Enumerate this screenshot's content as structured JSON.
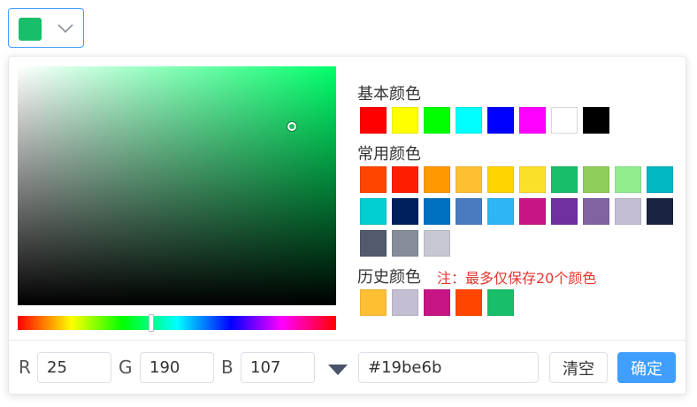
{
  "current_color": "#19be6b",
  "picker": {
    "hue_color": "#00ff6a",
    "hue_degrees": 150,
    "saturation_percent": 87,
    "value_percent": 75
  },
  "sections": {
    "basic_title": "基本颜色",
    "common_title": "常用颜色",
    "history_title": "历史颜色",
    "history_note": "注：最多仅保存20个颜色"
  },
  "basic_colors": [
    "#ff0000",
    "#ffff00",
    "#00ff00",
    "#00ffff",
    "#0000ff",
    "#ff00ff",
    "#ffffff",
    "#000000"
  ],
  "common_colors": [
    "#ff4500",
    "#ff1e02",
    "#ff9800",
    "#ffbf33",
    "#ffd400",
    "#fbe02a",
    "#19be6b",
    "#8fce5a",
    "#90ee90",
    "#00b7c2",
    "#00ced1",
    "#001f5c",
    "#0070c0",
    "#4a7bc0",
    "#2db5f5",
    "#c71585",
    "#7030a0",
    "#8064a2",
    "#c4bed2",
    "#1a2340",
    "#525a6e",
    "#878c9a",
    "#c5c8d0"
  ],
  "history_colors": [
    "#ffbf33",
    "#c4bed2",
    "#c71585",
    "#ff4500",
    "#19be6b"
  ],
  "channels": {
    "r_label": "R",
    "r_value": "25",
    "g_label": "G",
    "g_value": "190",
    "b_label": "B",
    "b_value": "107"
  },
  "hex_value": "#19be6b",
  "buttons": {
    "clear": "清空",
    "confirm": "确定"
  }
}
